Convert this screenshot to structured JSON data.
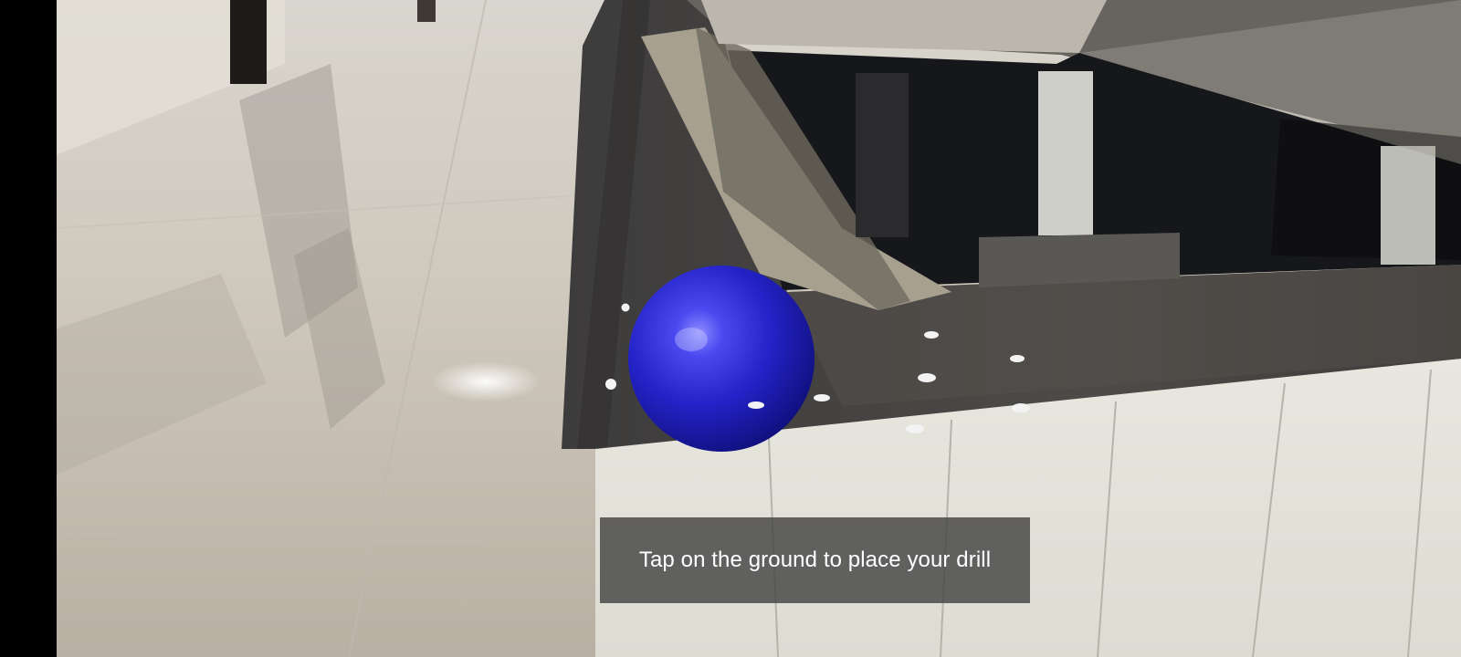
{
  "app": {
    "mode": "AR placement"
  },
  "status_indicator": {
    "color": "#16c65d"
  },
  "ar_scene": {
    "anchor_icon": "blue-sphere-icon",
    "sphere_color": "#2222c9",
    "plane_point_color": "#f0f0f0"
  },
  "instruction": {
    "text": "Tap on the ground to place your drill"
  }
}
